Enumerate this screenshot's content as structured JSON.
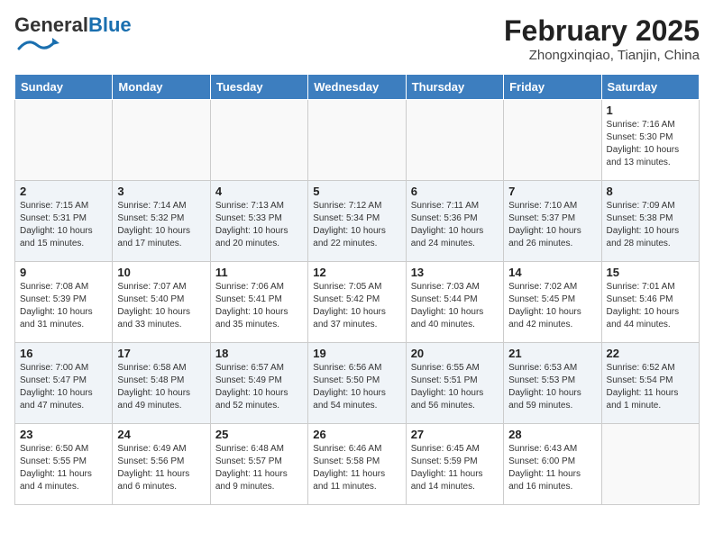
{
  "header": {
    "logo_general": "General",
    "logo_blue": "Blue",
    "month_year": "February 2025",
    "location": "Zhongxinqiao, Tianjin, China"
  },
  "days_of_week": [
    "Sunday",
    "Monday",
    "Tuesday",
    "Wednesday",
    "Thursday",
    "Friday",
    "Saturday"
  ],
  "weeks": [
    [
      {
        "day": "",
        "detail": ""
      },
      {
        "day": "",
        "detail": ""
      },
      {
        "day": "",
        "detail": ""
      },
      {
        "day": "",
        "detail": ""
      },
      {
        "day": "",
        "detail": ""
      },
      {
        "day": "",
        "detail": ""
      },
      {
        "day": "1",
        "detail": "Sunrise: 7:16 AM\nSunset: 5:30 PM\nDaylight: 10 hours and 13 minutes."
      }
    ],
    [
      {
        "day": "2",
        "detail": "Sunrise: 7:15 AM\nSunset: 5:31 PM\nDaylight: 10 hours and 15 minutes."
      },
      {
        "day": "3",
        "detail": "Sunrise: 7:14 AM\nSunset: 5:32 PM\nDaylight: 10 hours and 17 minutes."
      },
      {
        "day": "4",
        "detail": "Sunrise: 7:13 AM\nSunset: 5:33 PM\nDaylight: 10 hours and 20 minutes."
      },
      {
        "day": "5",
        "detail": "Sunrise: 7:12 AM\nSunset: 5:34 PM\nDaylight: 10 hours and 22 minutes."
      },
      {
        "day": "6",
        "detail": "Sunrise: 7:11 AM\nSunset: 5:36 PM\nDaylight: 10 hours and 24 minutes."
      },
      {
        "day": "7",
        "detail": "Sunrise: 7:10 AM\nSunset: 5:37 PM\nDaylight: 10 hours and 26 minutes."
      },
      {
        "day": "8",
        "detail": "Sunrise: 7:09 AM\nSunset: 5:38 PM\nDaylight: 10 hours and 28 minutes."
      }
    ],
    [
      {
        "day": "9",
        "detail": "Sunrise: 7:08 AM\nSunset: 5:39 PM\nDaylight: 10 hours and 31 minutes."
      },
      {
        "day": "10",
        "detail": "Sunrise: 7:07 AM\nSunset: 5:40 PM\nDaylight: 10 hours and 33 minutes."
      },
      {
        "day": "11",
        "detail": "Sunrise: 7:06 AM\nSunset: 5:41 PM\nDaylight: 10 hours and 35 minutes."
      },
      {
        "day": "12",
        "detail": "Sunrise: 7:05 AM\nSunset: 5:42 PM\nDaylight: 10 hours and 37 minutes."
      },
      {
        "day": "13",
        "detail": "Sunrise: 7:03 AM\nSunset: 5:44 PM\nDaylight: 10 hours and 40 minutes."
      },
      {
        "day": "14",
        "detail": "Sunrise: 7:02 AM\nSunset: 5:45 PM\nDaylight: 10 hours and 42 minutes."
      },
      {
        "day": "15",
        "detail": "Sunrise: 7:01 AM\nSunset: 5:46 PM\nDaylight: 10 hours and 44 minutes."
      }
    ],
    [
      {
        "day": "16",
        "detail": "Sunrise: 7:00 AM\nSunset: 5:47 PM\nDaylight: 10 hours and 47 minutes."
      },
      {
        "day": "17",
        "detail": "Sunrise: 6:58 AM\nSunset: 5:48 PM\nDaylight: 10 hours and 49 minutes."
      },
      {
        "day": "18",
        "detail": "Sunrise: 6:57 AM\nSunset: 5:49 PM\nDaylight: 10 hours and 52 minutes."
      },
      {
        "day": "19",
        "detail": "Sunrise: 6:56 AM\nSunset: 5:50 PM\nDaylight: 10 hours and 54 minutes."
      },
      {
        "day": "20",
        "detail": "Sunrise: 6:55 AM\nSunset: 5:51 PM\nDaylight: 10 hours and 56 minutes."
      },
      {
        "day": "21",
        "detail": "Sunrise: 6:53 AM\nSunset: 5:53 PM\nDaylight: 10 hours and 59 minutes."
      },
      {
        "day": "22",
        "detail": "Sunrise: 6:52 AM\nSunset: 5:54 PM\nDaylight: 11 hours and 1 minute."
      }
    ],
    [
      {
        "day": "23",
        "detail": "Sunrise: 6:50 AM\nSunset: 5:55 PM\nDaylight: 11 hours and 4 minutes."
      },
      {
        "day": "24",
        "detail": "Sunrise: 6:49 AM\nSunset: 5:56 PM\nDaylight: 11 hours and 6 minutes."
      },
      {
        "day": "25",
        "detail": "Sunrise: 6:48 AM\nSunset: 5:57 PM\nDaylight: 11 hours and 9 minutes."
      },
      {
        "day": "26",
        "detail": "Sunrise: 6:46 AM\nSunset: 5:58 PM\nDaylight: 11 hours and 11 minutes."
      },
      {
        "day": "27",
        "detail": "Sunrise: 6:45 AM\nSunset: 5:59 PM\nDaylight: 11 hours and 14 minutes."
      },
      {
        "day": "28",
        "detail": "Sunrise: 6:43 AM\nSunset: 6:00 PM\nDaylight: 11 hours and 16 minutes."
      },
      {
        "day": "",
        "detail": ""
      }
    ]
  ]
}
